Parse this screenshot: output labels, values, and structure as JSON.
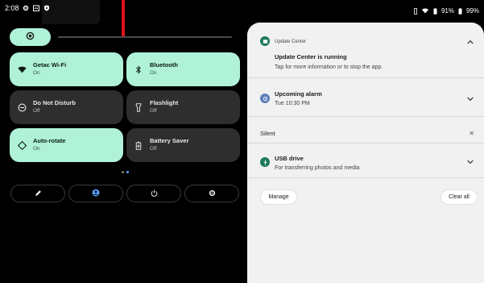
{
  "status_bar": {
    "time": "2:08",
    "battery_percent": "91%",
    "battery_percent_2": "99%",
    "icons": [
      "gear-icon",
      "calendar-icon",
      "shield-icon",
      "vibrate-icon",
      "wifi-icon",
      "battery-icon"
    ]
  },
  "brightness": {
    "level": 0.18,
    "icon": "brightness-icon"
  },
  "tiles": [
    {
      "name": "Getac Wi-Fi",
      "state": "On",
      "active": true,
      "icon": "wifi-icon"
    },
    {
      "name": "Bluetooth",
      "state": "On",
      "active": true,
      "icon": "bluetooth-icon"
    },
    {
      "name": "Do Not Disturb",
      "state": "Off",
      "active": false,
      "icon": "dnd-icon"
    },
    {
      "name": "Flashlight",
      "state": "Off",
      "active": false,
      "icon": "flashlight-icon"
    },
    {
      "name": "Auto-rotate",
      "state": "On",
      "active": true,
      "icon": "rotate-icon"
    },
    {
      "name": "Battery Saver",
      "state": "Off",
      "active": false,
      "icon": "battery-saver-icon"
    }
  ],
  "page_indicator": {
    "pages": 2,
    "current": 2
  },
  "controls": [
    "edit-icon",
    "user-icon",
    "power-icon",
    "settings-icon"
  ],
  "notifications": {
    "update_center": {
      "app_name": "Update Center",
      "title": "Update Center is running",
      "text": "Tap for more information or to stop the app."
    },
    "alarm": {
      "title": "Upcoming alarm",
      "text": "Tue 10:30 PM"
    },
    "silent_label": "Silent",
    "usb": {
      "title": "USB drive",
      "text": "For transferring photos and media"
    },
    "manage_label": "Manage",
    "clear_all_label": "Clear all"
  },
  "colors": {
    "tile_on": "#aff2d8",
    "tile_off": "#2e2e2e",
    "shade_bg": "#f1f1f1",
    "accent_blue": "#5aa5ff",
    "update_icon_bg": "#1b7a5a",
    "alarm_icon_bg": "#5b7fb8",
    "usb_icon_bg": "#1b7a5a"
  }
}
